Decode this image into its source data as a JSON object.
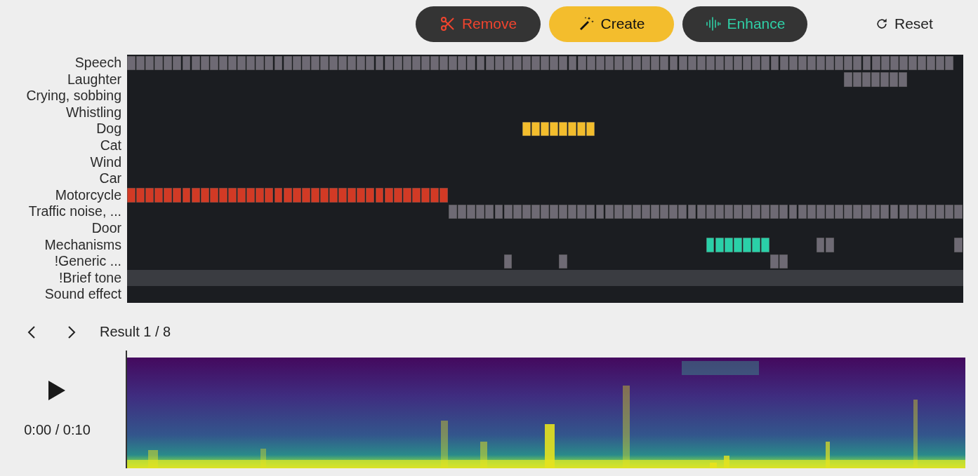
{
  "toolbar": {
    "buttons": [
      {
        "kind": "remove",
        "label": "Remove"
      },
      {
        "kind": "create",
        "label": "Create"
      },
      {
        "kind": "enhance",
        "label": "Enhance"
      }
    ],
    "reset": "Reset"
  },
  "grid": {
    "rows": [
      {
        "label": "Speech",
        "selected": false
      },
      {
        "label": "Laughter",
        "selected": false
      },
      {
        "label": "Crying, sobbing",
        "selected": false
      },
      {
        "label": "Whistling",
        "selected": false
      },
      {
        "label": "Dog",
        "selected": false
      },
      {
        "label": "Cat",
        "selected": false
      },
      {
        "label": "Wind",
        "selected": false
      },
      {
        "label": "Car",
        "selected": false
      },
      {
        "label": "Motorcycle",
        "selected": false
      },
      {
        "label": "Traffic noise, ...",
        "selected": false
      },
      {
        "label": "Door",
        "selected": false
      },
      {
        "label": "Mechanisms",
        "selected": false
      },
      {
        "label": "!Generic ...",
        "selected": false
      },
      {
        "label": "!Brief tone",
        "selected": true
      },
      {
        "label": "Sound effect",
        "selected": false
      }
    ]
  },
  "player": {
    "result": "Result 1 / 8",
    "time": "0:00 / 0:10"
  }
}
